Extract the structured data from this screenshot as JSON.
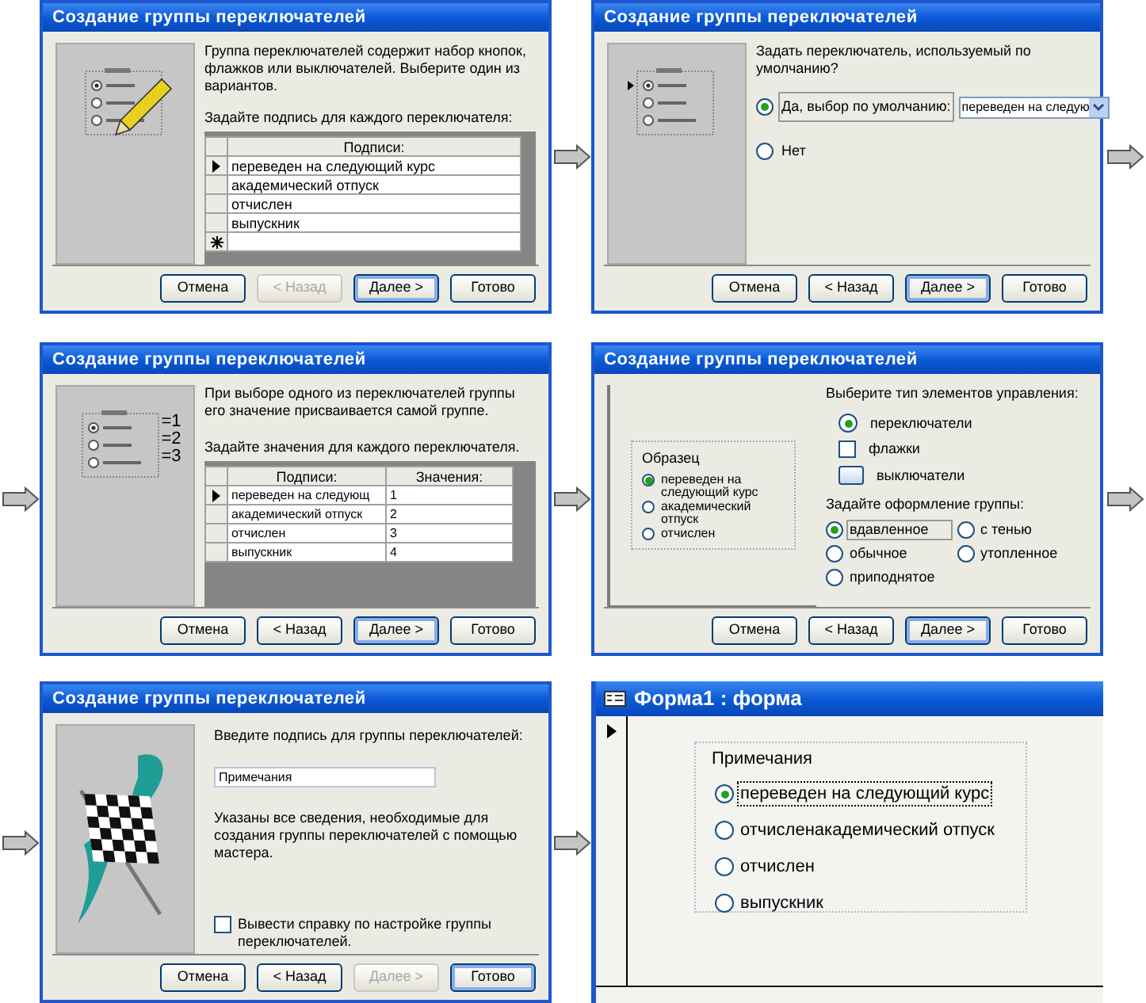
{
  "dialogs": [
    {
      "kind": "labels",
      "title": "Создание группы переключателей",
      "intro": "Группа переключателей содержит набор кнопок, флажков или выключателей. Выберите один из вариантов.",
      "prompt": "Задайте подпись для каждого переключателя:",
      "table": {
        "columns": [
          "Подписи:"
        ],
        "rows": [
          {
            "cells": [
              "переведен на следующий курс"
            ],
            "current": true
          },
          {
            "cells": [
              "академический отпуск"
            ],
            "current": false
          },
          {
            "cells": [
              "отчислен"
            ],
            "current": false
          },
          {
            "cells": [
              "выпускник"
            ],
            "current": false
          }
        ],
        "new_row": true
      },
      "buttons": [
        {
          "label": "Отмена",
          "disabled": false,
          "default": false
        },
        {
          "label": "< Назад",
          "disabled": true,
          "default": false
        },
        {
          "label": "Далее >",
          "disabled": false,
          "default": true
        },
        {
          "label": "Готово",
          "disabled": false,
          "default": false
        }
      ]
    },
    {
      "kind": "default_choice",
      "title": "Создание группы переключателей",
      "question": "Задать переключатель, используемый по умолчанию?",
      "options": [
        {
          "label": "Да, выбор по умолчанию:",
          "selected": true
        },
        {
          "label": "Нет",
          "selected": false
        }
      ],
      "dropdown": {
        "value": "переведен на следую"
      },
      "buttons": [
        {
          "label": "Отмена",
          "disabled": false,
          "default": false
        },
        {
          "label": "< Назад",
          "disabled": false,
          "default": false
        },
        {
          "label": "Далее >",
          "disabled": false,
          "default": true
        },
        {
          "label": "Готово",
          "disabled": false,
          "default": false
        }
      ]
    },
    {
      "kind": "values",
      "title": "Создание группы переключателей",
      "intro": "При выборе одного из переключателей группы его значение присваивается самой группе.",
      "prompt": "Задайте значения для каждого переключателя.",
      "sample_values": [
        "=1",
        "=2",
        "=3"
      ],
      "table": {
        "columns": [
          "Подписи:",
          "Значения:"
        ],
        "rows": [
          {
            "cells": [
              "переведен на следующ",
              "1"
            ],
            "current": true
          },
          {
            "cells": [
              "академический отпуск",
              "2"
            ],
            "current": false
          },
          {
            "cells": [
              "отчислен",
              "3"
            ],
            "current": false
          },
          {
            "cells": [
              "выпускник",
              "4"
            ],
            "current": false
          }
        ],
        "new_row": false
      },
      "buttons": [
        {
          "label": "Отмена",
          "disabled": false,
          "default": false
        },
        {
          "label": "< Назад",
          "disabled": false,
          "default": false
        },
        {
          "label": "Далее >",
          "disabled": false,
          "default": true
        },
        {
          "label": "Готово",
          "disabled": false,
          "default": false
        }
      ]
    },
    {
      "kind": "style",
      "title": "Создание группы переключателей",
      "prompt": "Выберите тип элементов управления:",
      "sample": {
        "caption": "Образец",
        "options": [
          {
            "label": "переведен на следующий курс",
            "selected": true
          },
          {
            "label": "академический отпуск",
            "selected": false
          },
          {
            "label": "отчислен",
            "selected": false
          }
        ]
      },
      "control_types": [
        {
          "kind": "radio",
          "label": "переключатели",
          "selected": true
        },
        {
          "kind": "checkbox",
          "label": "флажки",
          "selected": false
        },
        {
          "kind": "toggle",
          "label": "выключатели",
          "selected": false
        }
      ],
      "style_prompt": "Задайте оформление группы:",
      "styles": [
        {
          "label": "вдавленное",
          "selected": true
        },
        {
          "label": "с тенью",
          "selected": false
        },
        {
          "label": "обычное",
          "selected": false
        },
        {
          "label": "утопленное",
          "selected": false
        },
        {
          "label": "приподнятое",
          "selected": false
        }
      ],
      "buttons": [
        {
          "label": "Отмена",
          "disabled": false,
          "default": false
        },
        {
          "label": "< Назад",
          "disabled": false,
          "default": false
        },
        {
          "label": "Далее >",
          "disabled": false,
          "default": true
        },
        {
          "label": "Готово",
          "disabled": false,
          "default": false
        }
      ]
    },
    {
      "kind": "finish",
      "title": "Создание группы переключателей",
      "prompt": "Введите подпись для группы переключателей:",
      "caption_field": {
        "value": "Примечания"
      },
      "note": "Указаны все сведения, необходимые для создания группы переключателей с помощью мастера.",
      "help_checkbox": {
        "label": "Вывести справку по настройке группы переключателей.",
        "checked": false
      },
      "buttons": [
        {
          "label": "Отмена",
          "disabled": false,
          "default": false
        },
        {
          "label": "< Назад",
          "disabled": false,
          "default": false
        },
        {
          "label": "Далее >",
          "disabled": true,
          "default": false
        },
        {
          "label": "Готово",
          "disabled": false,
          "default": true
        }
      ]
    }
  ],
  "form": {
    "title": "Форма1 : форма",
    "group": {
      "caption": "Примечания",
      "options": [
        {
          "label": "переведен на следующий курс",
          "selected": true
        },
        {
          "label": "отчисленакадемический отпуск",
          "selected": false
        },
        {
          "label": "отчислен",
          "selected": false
        },
        {
          "label": "выпускник",
          "selected": false
        }
      ]
    }
  }
}
